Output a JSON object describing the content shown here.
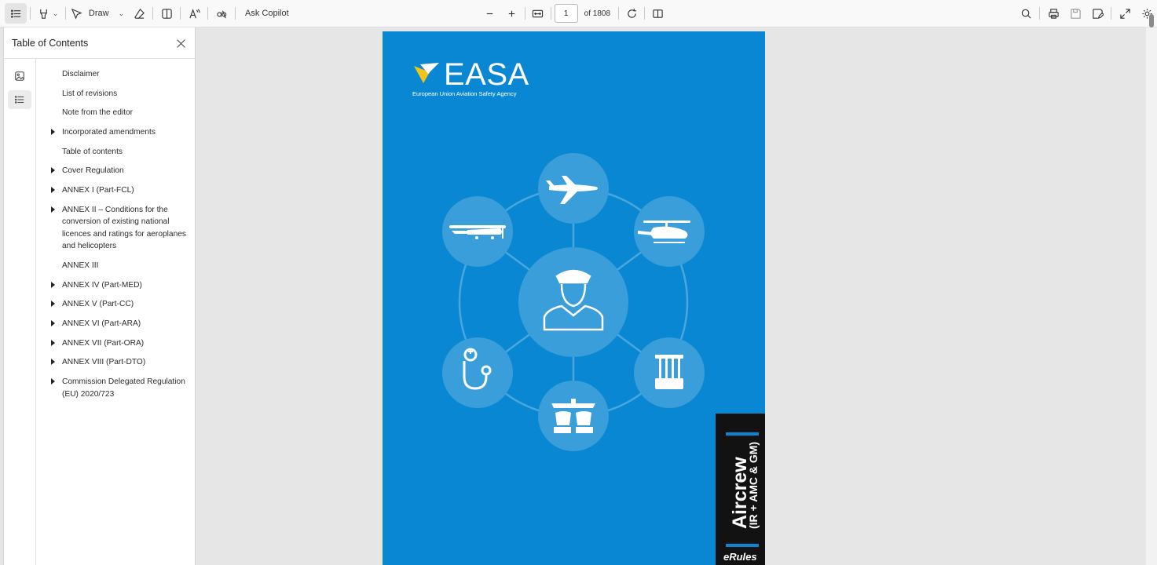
{
  "toolbar": {
    "draw_label": "Draw",
    "ask_copilot_label": "Ask Copilot",
    "page_value": "1",
    "page_total": "of 1808"
  },
  "sidebar": {
    "title": "Table of Contents",
    "items": [
      {
        "label": "Disclaimer",
        "expandable": false
      },
      {
        "label": "List of revisions",
        "expandable": false
      },
      {
        "label": "Note from the editor",
        "expandable": false
      },
      {
        "label": "Incorporated amendments",
        "expandable": true
      },
      {
        "label": "Table of contents",
        "expandable": false
      },
      {
        "label": "Cover Regulation",
        "expandable": true
      },
      {
        "label": "ANNEX I (Part-FCL)",
        "expandable": true
      },
      {
        "label": "ANNEX II – Conditions for the conversion of existing national licences and ratings for aeroplanes and helicopters",
        "expandable": true
      },
      {
        "label": "ANNEX III",
        "expandable": false
      },
      {
        "label": "ANNEX IV (Part-MED)",
        "expandable": true
      },
      {
        "label": "ANNEX V (Part-CC)",
        "expandable": true
      },
      {
        "label": "ANNEX VI (Part-ARA)",
        "expandable": true
      },
      {
        "label": "ANNEX VII (Part-ORA)",
        "expandable": true
      },
      {
        "label": "ANNEX VIII (Part-DTO)",
        "expandable": true
      },
      {
        "label": "Commission Delegated Regulation (EU) 2020/723",
        "expandable": true
      }
    ]
  },
  "document": {
    "logo_text": "EASA",
    "logo_subtitle": "European Union Aviation Safety Agency",
    "band_title": "Aircrew",
    "band_subtitle": "(IR + AMC & GM)",
    "band_footer": "eRules",
    "background_color": "#0a87d2",
    "band_color": "#121212",
    "logo_accent": "#f0c419"
  }
}
